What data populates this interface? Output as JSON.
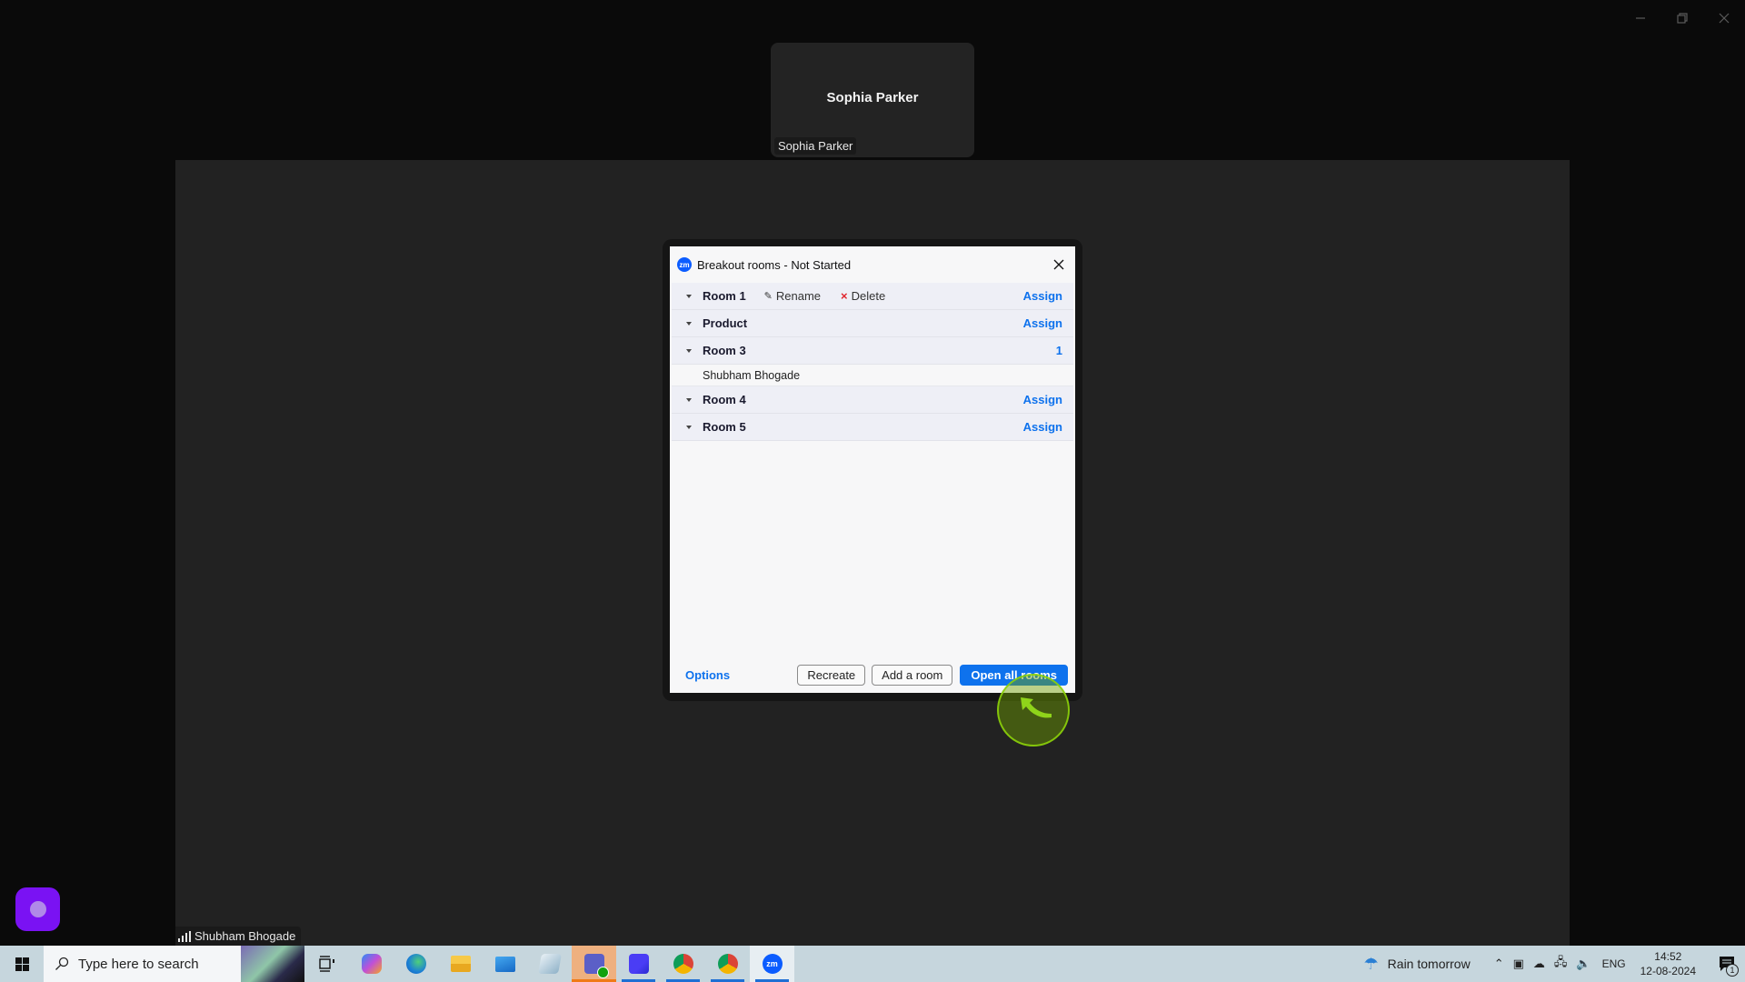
{
  "window": {
    "controls": {
      "minimize": "minimize",
      "restore": "restore",
      "close": "close"
    }
  },
  "top_tile": {
    "center_name": "Sophia Parker",
    "label": "Sophia Parker"
  },
  "stage": {
    "label": "Shubham Bhogade"
  },
  "dialog": {
    "title": "Breakout rooms - Not Started",
    "logo_text": "zm",
    "rooms": [
      {
        "name": "Room 1",
        "rename_label": "Rename",
        "delete_label": "Delete",
        "action": "Assign"
      },
      {
        "name": "Product",
        "action": "Assign"
      },
      {
        "name": "Room 3",
        "count": "1",
        "participants": [
          "Shubham Bhogade"
        ]
      },
      {
        "name": "Room 4",
        "action": "Assign"
      },
      {
        "name": "Room 5",
        "action": "Assign"
      }
    ],
    "footer": {
      "options_label": "Options",
      "recreate_label": "Recreate",
      "add_room_label": "Add a room",
      "open_all_label": "Open all rooms"
    }
  },
  "taskbar": {
    "search_placeholder": "Type here to search",
    "apps": [
      "task-view",
      "copilot",
      "edge",
      "file-explorer",
      "mail",
      "notepad",
      "teams",
      "remote-app",
      "chrome-profile-1",
      "chrome-profile-s",
      "zoom"
    ],
    "weather": "Rain tomorrow",
    "language": "ENG",
    "time": "14:52",
    "date": "12-08-2024",
    "notification_count": "1"
  },
  "colors": {
    "accent_blue": "#0e72ed",
    "zoom_blue": "#0b5cff",
    "delete_red": "#e0262e",
    "purple_button": "#7a12f3"
  }
}
